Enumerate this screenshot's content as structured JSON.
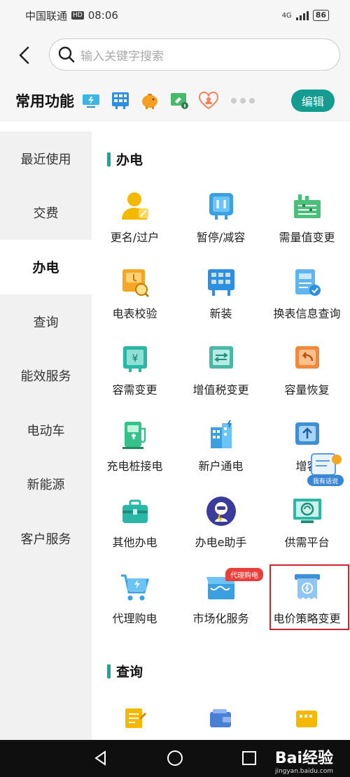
{
  "status": {
    "carrier": "中国联通",
    "hd": "HD",
    "time": "08:06",
    "network": "4G",
    "battery": "86"
  },
  "search": {
    "placeholder": "输入关键字搜索"
  },
  "quick": {
    "title": "常用功能",
    "edit_label": "编辑"
  },
  "sidebar": {
    "items": [
      {
        "label": "最近使用"
      },
      {
        "label": "交费"
      },
      {
        "label": "办电"
      },
      {
        "label": "查询"
      },
      {
        "label": "能效服务"
      },
      {
        "label": "电动车"
      },
      {
        "label": "新能源"
      },
      {
        "label": "客户服务"
      }
    ],
    "active": "办电"
  },
  "section1": {
    "title": "办电",
    "items": [
      {
        "label": "更名/过户",
        "icon": "user-rename-icon"
      },
      {
        "label": "暂停/减容",
        "icon": "pause-capacity-icon"
      },
      {
        "label": "需量值变更",
        "icon": "demand-change-icon"
      },
      {
        "label": "电表校验",
        "icon": "meter-check-icon"
      },
      {
        "label": "新装",
        "icon": "new-install-icon"
      },
      {
        "label": "换表信息查询",
        "icon": "meter-info-icon"
      },
      {
        "label": "容需变更",
        "icon": "capacity-demand-icon"
      },
      {
        "label": "增值税变更",
        "icon": "vat-change-icon"
      },
      {
        "label": "容量恢复",
        "icon": "capacity-restore-icon"
      },
      {
        "label": "充电桩接电",
        "icon": "charger-icon"
      },
      {
        "label": "新户通电",
        "icon": "new-household-icon"
      },
      {
        "label": "增容",
        "icon": "capacity-increase-icon"
      },
      {
        "label": "其他办电",
        "icon": "briefcase-icon"
      },
      {
        "label": "办电e助手",
        "icon": "robot-icon"
      },
      {
        "label": "供需平台",
        "icon": "platform-icon"
      },
      {
        "label": "代理购电",
        "icon": "cart-icon"
      },
      {
        "label": "市场化服务",
        "icon": "market-icon"
      },
      {
        "label": "电价策略变更",
        "icon": "price-strategy-icon"
      }
    ]
  },
  "tag_label": "代理购电",
  "chat_label": "我有话说",
  "section2": {
    "title": "查询"
  },
  "watermark": {
    "brand": "Bai经验",
    "url": "jingyan.baidu.com"
  }
}
